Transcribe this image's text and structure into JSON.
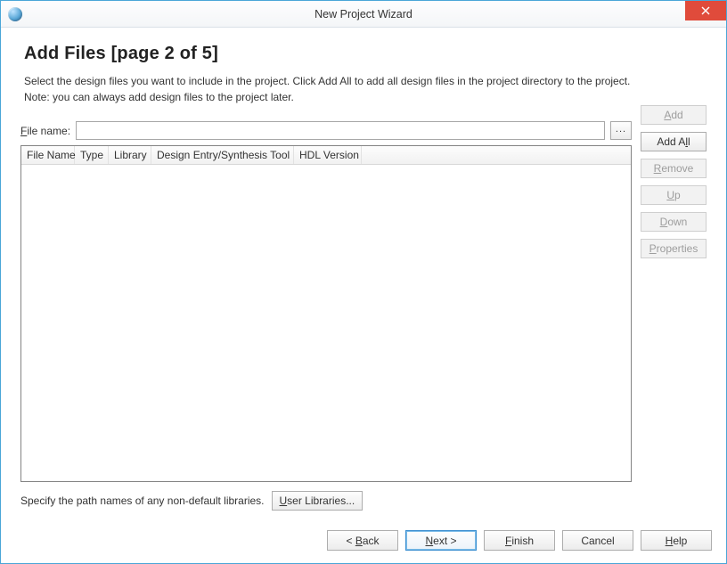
{
  "window": {
    "title": "New Project Wizard"
  },
  "page": {
    "title": "Add Files [page 2 of 5]",
    "desc1": "Select the design files you want to include in the project. Click Add All to add all design files in the project directory to the project.",
    "desc2": "Note: you can always add design files to the project later."
  },
  "filename": {
    "label": "File name:",
    "value": "",
    "browse": "..."
  },
  "side_buttons": {
    "add": "Add",
    "add_all": "Add All",
    "remove": "Remove",
    "up": "Up",
    "down": "Down",
    "properties": "Properties"
  },
  "columns": {
    "file_name": "File Name",
    "type": "Type",
    "library": "Library",
    "design_entry": "Design Entry/Synthesis Tool",
    "hdl_version": "HDL Version"
  },
  "libraries": {
    "text": "Specify the path names of any non-default libraries.",
    "button": "User Libraries..."
  },
  "footer": {
    "back": "< Back",
    "next": "Next >",
    "finish": "Finish",
    "cancel": "Cancel",
    "help": "Help"
  }
}
